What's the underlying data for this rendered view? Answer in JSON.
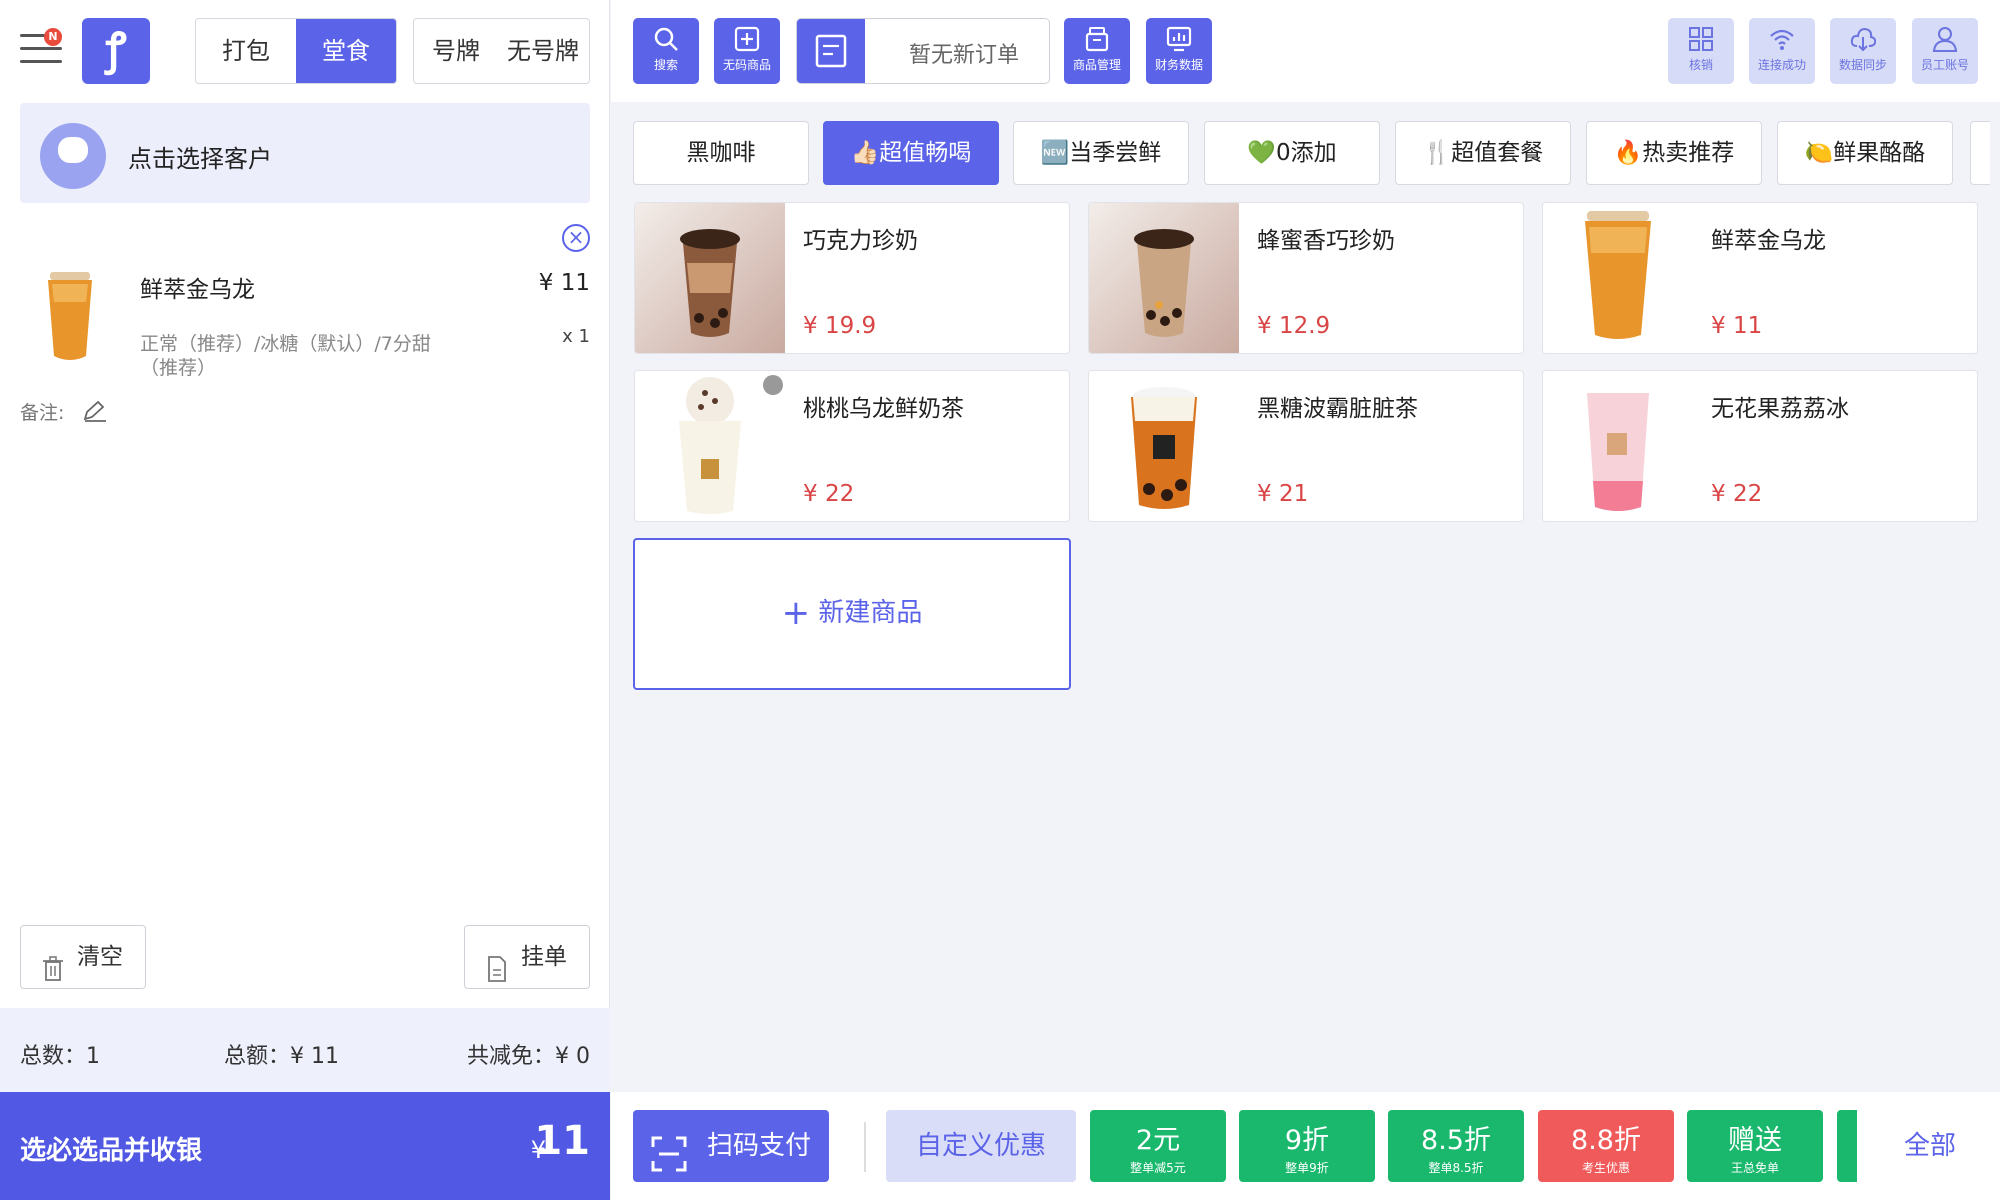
{
  "header": {
    "menu_badge": "N",
    "logo_text": "ꝭ",
    "order_type": {
      "takeaway": "打包",
      "dine_in": "堂食",
      "selected": "dine_in"
    },
    "number_plate": {
      "with": "号牌",
      "without": "无号牌"
    }
  },
  "customer": {
    "label": "点击选择客户"
  },
  "order": {
    "items": [
      {
        "name": "鲜萃金乌龙",
        "price": "¥ 11",
        "qty": "x 1",
        "desc": "正常（推荐）/冰糖（默认）/7分甜（推荐）"
      }
    ],
    "memo_label": "备注:"
  },
  "actions": {
    "clear": "清空",
    "hold": "挂单"
  },
  "totals": {
    "count": "总数：1",
    "amount": "总额：¥ 11",
    "discount": "共减免：¥ 0"
  },
  "checkout": {
    "label": "选必选品并收银",
    "currency": "¥",
    "amount": "11"
  },
  "toolbar": {
    "search": "搜索",
    "no_barcode": "无码商品",
    "orders_status": "暂无新订单",
    "product_mgmt": "商品管理",
    "finance": "财务数据",
    "verify": "核销",
    "connection": "连接成功",
    "sync": "数据同步",
    "staff": "员工账号"
  },
  "categories": [
    {
      "label": "黑咖啡"
    },
    {
      "label": "👍🏻超值畅喝"
    },
    {
      "label": "🆕当季尝鲜"
    },
    {
      "label": "💚0添加"
    },
    {
      "label": "🍴超值套餐"
    },
    {
      "label": "🔥热卖推荐"
    },
    {
      "label": "🍋鲜果酪酪"
    }
  ],
  "selected_category": 1,
  "products": [
    {
      "name": "巧克力珍奶",
      "price": "¥ 19.9"
    },
    {
      "name": "蜂蜜香巧珍奶",
      "price": "¥ 12.9"
    },
    {
      "name": "鲜萃金乌龙",
      "price": "¥ 11"
    },
    {
      "name": "桃桃乌龙鲜奶茶",
      "price": "¥ 22"
    },
    {
      "name": "黑糖波霸脏脏茶",
      "price": "¥ 21"
    },
    {
      "name": "无花果荔荔冰",
      "price": "¥ 22"
    }
  ],
  "new_product": "新建商品",
  "bottom": {
    "scan_pay": "扫码支付",
    "custom_discount": "自定义优惠",
    "discounts": [
      {
        "title": "2元",
        "sub": "整单减5元"
      },
      {
        "title": "9折",
        "sub": "整单9折"
      },
      {
        "title": "8.5折",
        "sub": "整单8.5折"
      },
      {
        "title": "8.8折",
        "sub": "考生优惠"
      },
      {
        "title": "赠送",
        "sub": "王总免单"
      }
    ],
    "all": "全部"
  },
  "colors": {
    "accent": "#5b63e8",
    "discount_green": "#19b86d",
    "discount_red": "#f05a5a",
    "price_red": "#d94545"
  }
}
